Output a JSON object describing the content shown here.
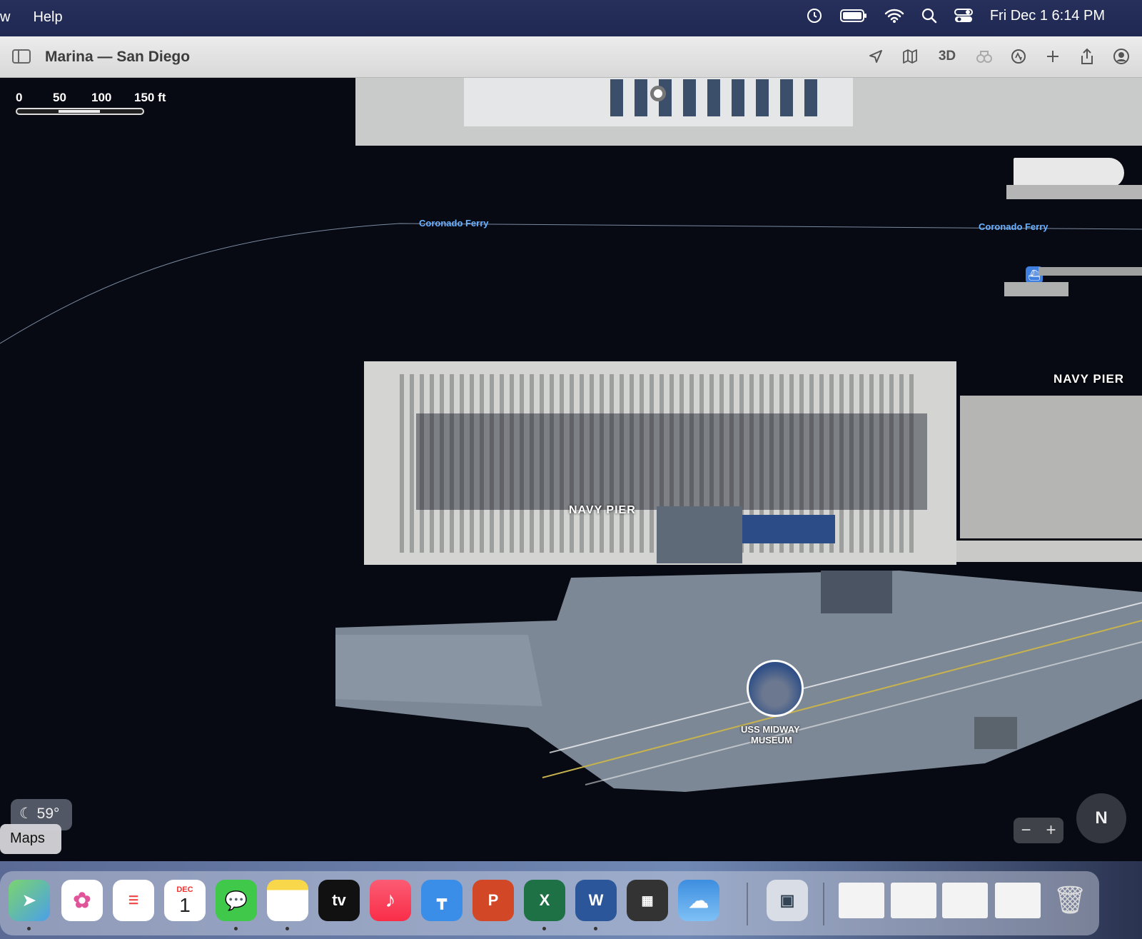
{
  "menubar": {
    "items": [
      "w",
      "Help"
    ],
    "clock": "Fri Dec 1  6:14 PM",
    "status_icons": [
      "time-machine-icon",
      "battery-icon",
      "wifi-icon",
      "spotlight-icon",
      "control-center-icon"
    ]
  },
  "window": {
    "title": "Marina — San Diego",
    "toolbar_3d": "3D"
  },
  "map": {
    "scale_labels": [
      "0",
      "50",
      "100",
      "150 ft"
    ],
    "labels": {
      "ferry_left": "Coronado Ferry",
      "ferry_right": "Coronado Ferry",
      "navy_pier_center": "NAVY PIER",
      "navy_pier_right": "NAVY PIER",
      "museum_line1": "USS MIDWAY",
      "museum_line2": "MUSEUM"
    },
    "weather": "59°",
    "compass": "N",
    "zoom_minus": "−",
    "zoom_plus": "+"
  },
  "tooltip": "Maps",
  "dock": {
    "calendar_month": "DEC",
    "calendar_day": "1",
    "tv_label": "tv",
    "powerpoint_letter": "P",
    "excel_letter": "X",
    "word_letter": "W",
    "apps": [
      "Maps",
      "Photos",
      "Reminders",
      "Calendar",
      "Messages",
      "Notes",
      "TV",
      "Music",
      "Keynote",
      "PowerPoint",
      "Excel",
      "Word",
      "Calculator",
      "Weather",
      "Preview",
      "Trash"
    ]
  }
}
